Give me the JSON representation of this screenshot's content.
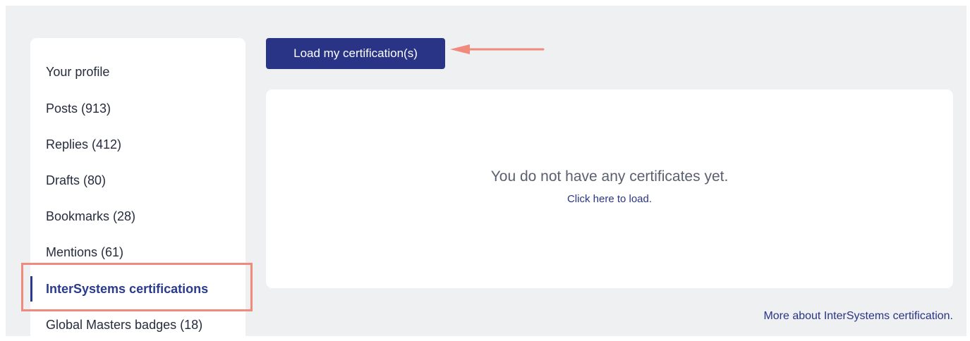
{
  "sidebar": {
    "items": [
      {
        "label": "Your profile"
      },
      {
        "label": "Posts (913)"
      },
      {
        "label": "Replies (412)"
      },
      {
        "label": "Drafts (80)"
      },
      {
        "label": "Bookmarks (28)"
      },
      {
        "label": "Mentions (61)"
      },
      {
        "label": "InterSystems certifications",
        "active": true
      },
      {
        "label": "Global Masters badges (18)"
      }
    ]
  },
  "main": {
    "load_button_label": "Load my certification(s)",
    "empty_message": "You do not have any certificates yet.",
    "load_link_label": "Click here to load.",
    "more_link_label": "More about InterSystems certification."
  },
  "colors": {
    "accent": "#2a3487",
    "annotation": "#ef8a7d",
    "page_background": "#eff0f2"
  }
}
